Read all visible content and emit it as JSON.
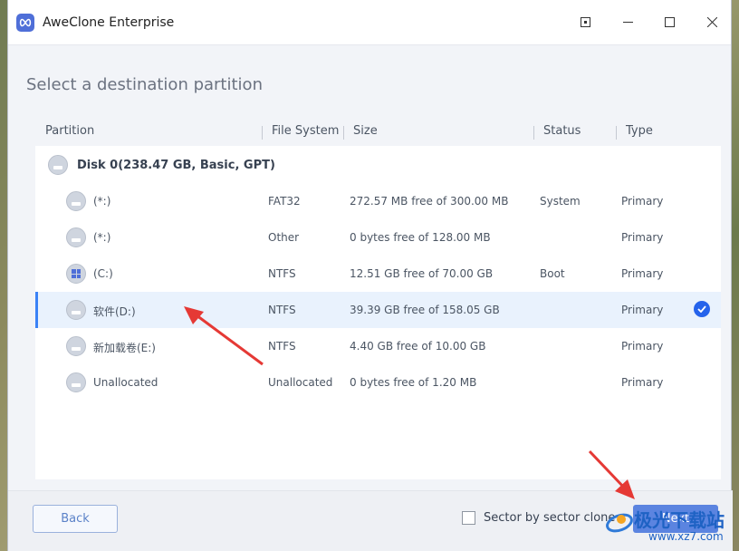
{
  "window": {
    "title": "AweClone Enterprise"
  },
  "page": {
    "heading": "Select a destination partition"
  },
  "table": {
    "headers": {
      "partition": "Partition",
      "file_system": "File System",
      "size": "Size",
      "status": "Status",
      "type": "Type"
    },
    "disk": {
      "label": "Disk 0(238.47 GB, Basic, GPT)"
    },
    "rows": [
      {
        "name": "(*:)",
        "fs": "FAT32",
        "size": "272.57 MB free of 300.00 MB",
        "status": "System",
        "type": "Primary",
        "icon": "disk-icon"
      },
      {
        "name": "(*:)",
        "fs": "Other",
        "size": "0 bytes free of 128.00 MB",
        "status": "",
        "type": "Primary",
        "icon": "disk-icon"
      },
      {
        "name": "(C:)",
        "fs": "NTFS",
        "size": "12.51 GB free of 70.00 GB",
        "status": "Boot",
        "type": "Primary",
        "icon": "windows-disk-icon"
      },
      {
        "name": "软件(D:)",
        "fs": "NTFS",
        "size": "39.39 GB free of 158.05 GB",
        "status": "",
        "type": "Primary",
        "icon": "disk-icon",
        "selected": true
      },
      {
        "name": "新加载卷(E:)",
        "fs": "NTFS",
        "size": "4.40 GB free of 10.00 GB",
        "status": "",
        "type": "Primary",
        "icon": "disk-icon"
      },
      {
        "name": "Unallocated",
        "fs": "Unallocated",
        "size": "0 bytes free of 1.20 MB",
        "status": "",
        "type": "Primary",
        "icon": "disk-icon"
      }
    ]
  },
  "footer": {
    "back_label": "Back",
    "sector_clone_label": "Sector by sector clone",
    "next_label": "Next"
  },
  "watermark": {
    "text": "极光下载站",
    "url": "www.xz7.com"
  },
  "colors": {
    "accent": "#3b82f6",
    "selected_bg": "#e9f2fd",
    "arrow": "#e53935"
  }
}
